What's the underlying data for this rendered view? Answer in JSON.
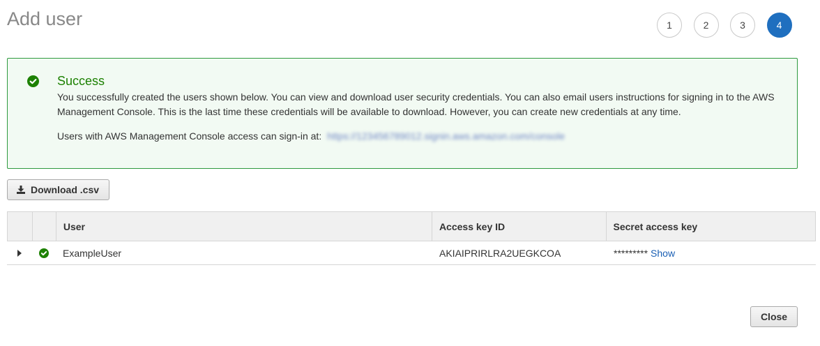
{
  "header": {
    "title": "Add user"
  },
  "wizard": {
    "steps": [
      "1",
      "2",
      "3",
      "4"
    ],
    "active_step": "4"
  },
  "alert": {
    "title": "Success",
    "message": "You successfully created the users shown below. You can view and download user security credentials. You can also email users instructions for signing in to the AWS Management Console. This is the last time these credentials will be available to download. However, you can create new credentials at any time.",
    "signin_text": "Users with AWS Management Console access can sign-in at:",
    "signin_url": "https://123456789012.signin.aws.amazon.com/console",
    "accent_color": "#1d8102"
  },
  "toolbar": {
    "download_label": "Download .csv"
  },
  "table": {
    "columns": [
      "User",
      "Access key ID",
      "Secret access key"
    ],
    "rows": [
      {
        "user": "ExampleUser",
        "access_key_id": "AKIAIPRIRLRA2UEGKCOA",
        "secret_masked": "*********",
        "secret_action": "Show",
        "status": "success"
      }
    ]
  },
  "footer": {
    "close_label": "Close"
  },
  "colors": {
    "primary": "#1f6fbf",
    "success": "#1d8102",
    "link": "#1a5fb4"
  }
}
